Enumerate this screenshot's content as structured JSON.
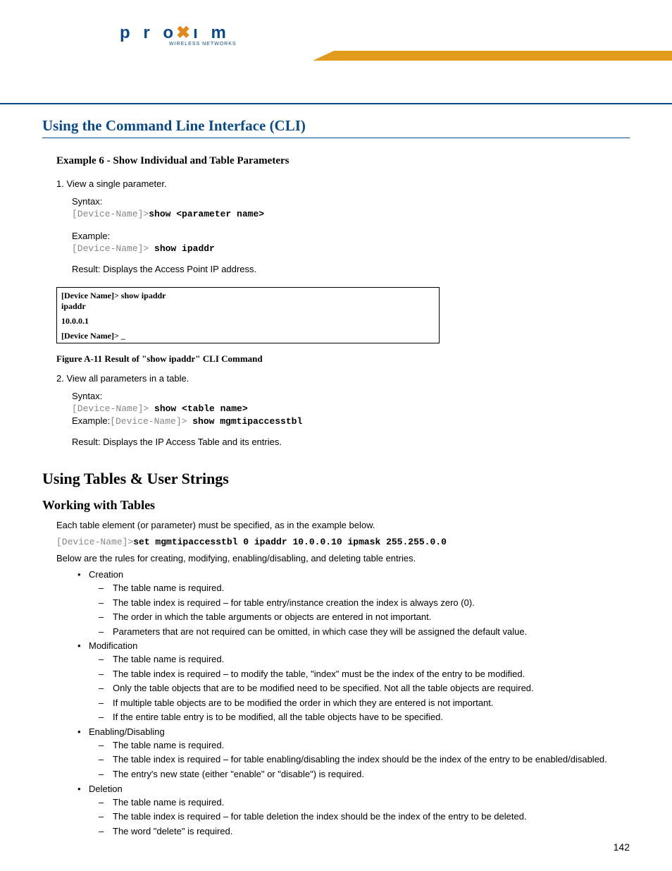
{
  "logo": {
    "brand_p": "p",
    "brand_r": "r",
    "brand_o1": "o",
    "brand_x": "x",
    "brand_i": "ı",
    "brand_m": "m",
    "tagline": "WIRELESS NETWORKS"
  },
  "section_title": "Using the Command Line Interface (CLI)",
  "example6": {
    "heading": "Example 6 - Show Individual and Table Parameters",
    "step1": "1. View a single parameter.",
    "syntax_label": "Syntax:",
    "syntax_prompt": "[Device-Name]>",
    "syntax_cmd": "show <parameter name>",
    "example_label": "Example:",
    "example_prompt": "[Device-Name]> ",
    "example_cmd": "show ipaddr",
    "result": "Result: Displays the Access Point IP address.",
    "terminal_l1": "[Device Name]> show ipaddr",
    "terminal_l2": "ipaddr",
    "terminal_l3": "10.0.0.1",
    "terminal_l4": "[Device Name]> _",
    "fig_caption": "Figure A-11   Result of \"show ipaddr\" CLI Command",
    "step2": "2. View all parameters in a table.",
    "syntax2_prompt": "[Device-Name]> ",
    "syntax2_cmd": "show <table name>",
    "example2_label": "Example:",
    "example2_prompt": "[Device-Name]> ",
    "example2_cmd": "show mgmtipaccesstbl",
    "result2": "Result: Displays the IP Access Table and its entries."
  },
  "h2": "Using Tables & User Strings",
  "h3": "Working with Tables",
  "para1": "Each table element (or parameter) must be specified, as in the example below.",
  "cmd_prompt": "[Device-Name]>",
  "cmd_body": "set mgmtipaccesstbl 0 ipaddr 10.0.0.10 ipmask 255.255.0.0",
  "para2": "Below are the rules for creating, modifying, enabling/disabling, and deleting table entries.",
  "rules": {
    "creation": {
      "title": "Creation",
      "items": [
        "The table name is required.",
        "The table index is required – for table entry/instance creation the index is always zero (0).",
        "The order in which the table arguments or objects are entered in not important.",
        "Parameters that are not required can be omitted, in which case they will be assigned the default value."
      ]
    },
    "modification": {
      "title": "Modification",
      "items": [
        "The table name is required.",
        "The table index is required – to modify the table, \"index\" must be the index of the entry to be modified.",
        "Only the table objects that are to be modified need to be specified. Not all the table objects are required.",
        "If multiple table objects are to be modified the order in which they are entered is not important.",
        "If the entire table entry is to be modified, all the table objects have to be specified."
      ]
    },
    "enabling": {
      "title": "Enabling/Disabling",
      "items": [
        "The table name is required.",
        "The table index is required – for table enabling/disabling the index should be the index of the entry to be enabled/disabled.",
        "The entry's new state (either \"enable\" or \"disable\") is required."
      ]
    },
    "deletion": {
      "title": "Deletion",
      "items": [
        "The table name is required.",
        "The table index is required – for table deletion the index should be the index of the entry to be deleted.",
        "The word \"delete\" is required."
      ]
    }
  },
  "page_number": "142"
}
